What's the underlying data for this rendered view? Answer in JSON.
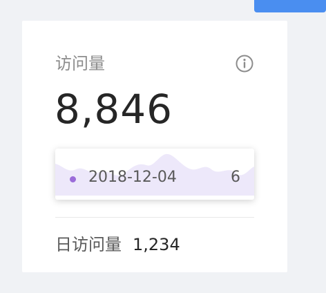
{
  "card": {
    "title": "访问量",
    "total_value": "8,846",
    "info_icon": "info-circle-icon",
    "tooltip": {
      "date": "2018-12-04",
      "value": "6",
      "dot_color": "#9b6cd9"
    },
    "footer": {
      "label": "日访问量",
      "value": "1,234"
    }
  },
  "colors": {
    "accent": "#4a8ef0",
    "sparkline_fill": "#ede8fa"
  }
}
